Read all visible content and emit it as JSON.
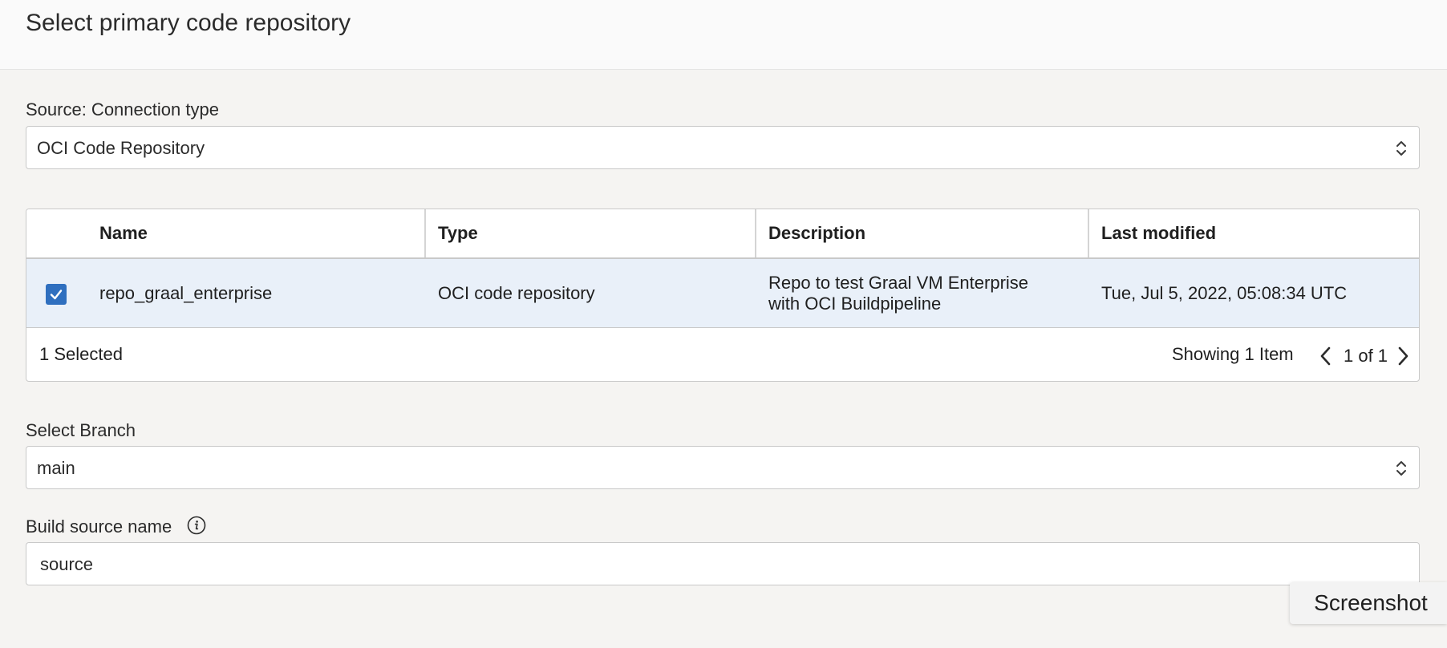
{
  "header": {
    "title": "Select primary code repository"
  },
  "connection": {
    "label": "Source: Connection type",
    "value": "OCI Code Repository"
  },
  "table": {
    "columns": [
      "Name",
      "Type",
      "Description",
      "Last modified"
    ],
    "rows": [
      {
        "selected": true,
        "name": "repo_graal_enterprise",
        "type": "OCI code repository",
        "description_line1": "Repo to test Graal VM Enterprise",
        "description_line2": "with OCI Buildpipeline",
        "last_modified": "Tue, Jul 5, 2022, 05:08:34 UTC"
      }
    ],
    "footer": {
      "selected_count": "1 Selected",
      "showing": "Showing 1 Item",
      "page_indicator": "1 of 1"
    }
  },
  "branch": {
    "label": "Select Branch",
    "value": "main"
  },
  "build_source": {
    "label": "Build source name",
    "value": "source"
  },
  "screenshot_button": {
    "label": "Screenshot"
  }
}
